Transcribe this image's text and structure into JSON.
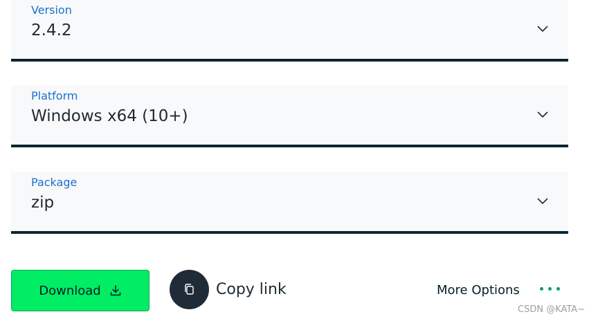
{
  "selects": [
    {
      "label": "Version",
      "value": "2.4.2",
      "icon": "chevron-down-icon"
    },
    {
      "label": "Platform",
      "value": "Windows x64 (10+)",
      "icon": "chevron-down-icon"
    },
    {
      "label": "Package",
      "value": "zip",
      "icon": "chevron-down-icon"
    }
  ],
  "actions": {
    "download_label": "Download",
    "download_icon": "download-icon",
    "copy_link_label": "Copy link",
    "copy_icon": "copy-icon",
    "more_options_label": "More Options",
    "more_icon": "more-dots-icon"
  },
  "watermark": "CSDN @KATA~",
  "colors": {
    "accent": "#00ed64",
    "label": "#1a6fd1",
    "border": "#0d2530",
    "dark": "#1f2c38",
    "dots": "#00a35c"
  }
}
